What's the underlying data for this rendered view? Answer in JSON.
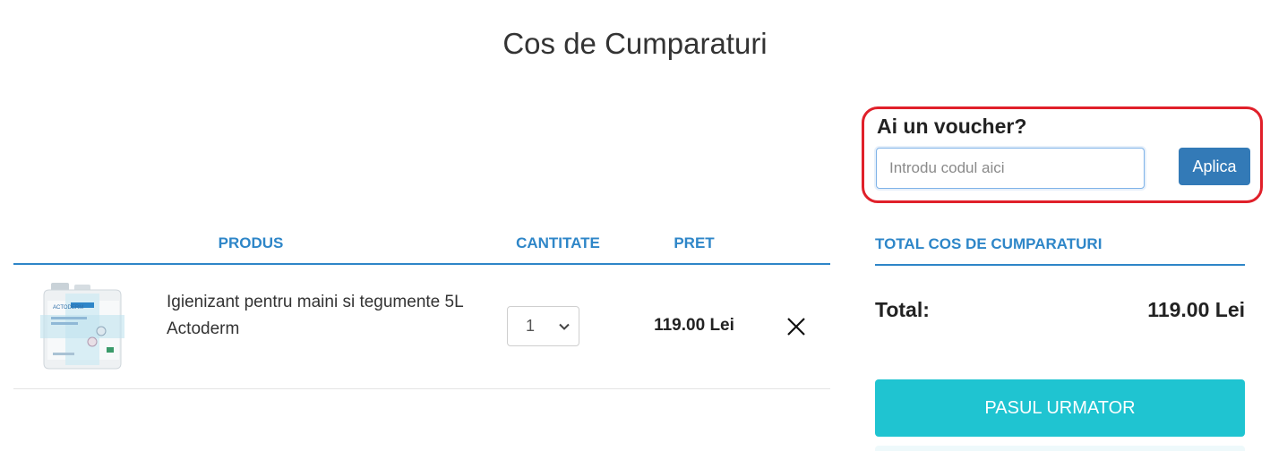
{
  "page": {
    "title": "Cos de Cumparaturi"
  },
  "voucher": {
    "title": "Ai un voucher?",
    "placeholder": "Introdu codul aici",
    "value": "",
    "apply_label": "Aplica",
    "highlight_color": "#e0202a"
  },
  "cart": {
    "columns": {
      "product": "PRODUS",
      "quantity": "CANTITATE",
      "price": "PRET"
    },
    "items": [
      {
        "image_icon": "product-canister-image",
        "name": "Igienizant pentru maini si tegumente 5L Actoderm",
        "quantity": "1",
        "price": "119.00 Lei",
        "remove_icon": "close-icon"
      }
    ]
  },
  "totals": {
    "title": "TOTAL COS DE CUMPARATURI",
    "total_label": "Total:",
    "total_value": "119.00 Lei",
    "next_label": "PASUL URMATOR"
  },
  "colors": {
    "accent_blue": "#2e86c8",
    "apply_button": "#337ab7",
    "next_button": "#1fc4d1"
  }
}
